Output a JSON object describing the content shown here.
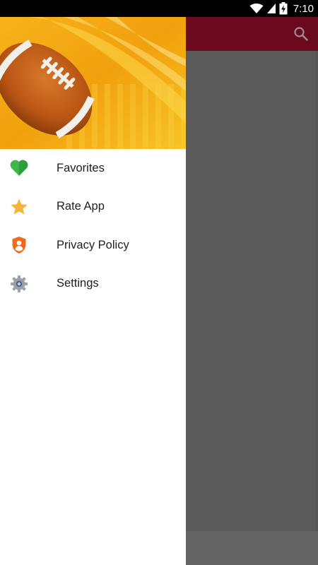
{
  "status_bar": {
    "time": "7:10",
    "icons": [
      "wifi-icon",
      "signal-icon",
      "battery-charging-icon"
    ]
  },
  "toolbar": {
    "color": "#6b0a1e",
    "search_icon": "search-icon"
  },
  "drawer": {
    "header_image": "american-football-banner",
    "items": [
      {
        "label": "Favorites",
        "icon": "heart-icon",
        "color": "#3fb54a"
      },
      {
        "label": "Rate App",
        "icon": "star-icon",
        "color": "#f6b43a"
      },
      {
        "label": "Privacy Policy",
        "icon": "shield-user-icon",
        "color": "#ee6b1e"
      },
      {
        "label": "Settings",
        "icon": "gear-icon",
        "color": "#9aa0a6"
      }
    ]
  }
}
